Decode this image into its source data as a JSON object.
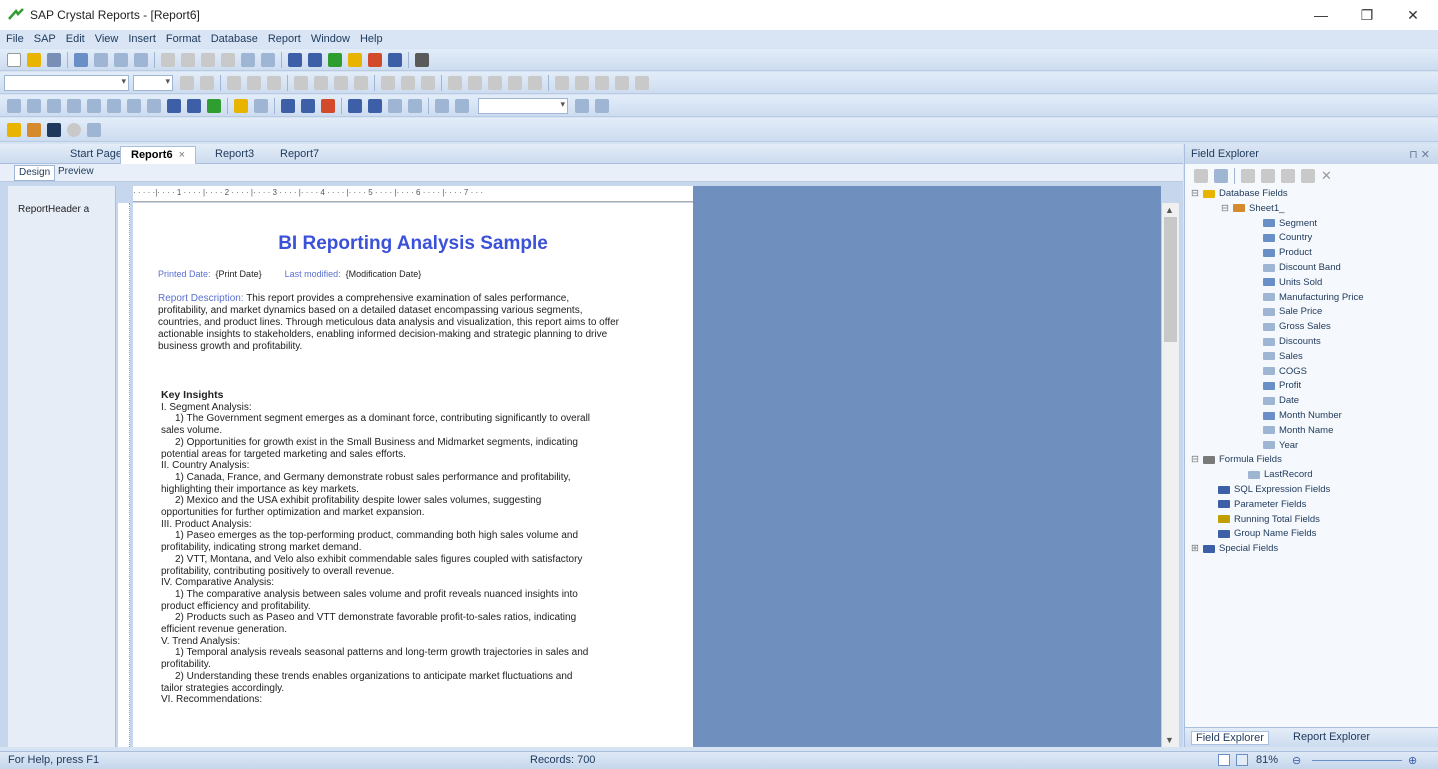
{
  "window": {
    "title": "SAP Crystal Reports - [Report6]",
    "minimize": "—",
    "restore": "❐",
    "close": "✕"
  },
  "menu": [
    "File",
    "SAP",
    "Edit",
    "View",
    "Insert",
    "Format",
    "Database",
    "Report",
    "Window",
    "Help"
  ],
  "tabs": {
    "start": "Start Page",
    "report6": "Report6",
    "close_x": "×",
    "report3": "Report3",
    "report7": "Report7"
  },
  "subtabs": {
    "design": "Design",
    "preview": "Preview"
  },
  "sections": {
    "report_header": "ReportHeader a"
  },
  "ruler": "· · · · ·|· · · · 1 · · · · |· · · · 2 · · · · |· · · · 3 · · · · |· · · · 4 · · · · |· · · · 5 · · · · |· · · · 6 · · · · |· · · · 7 · · ·",
  "report": {
    "title": "BI Reporting Analysis Sample",
    "printed_date_label": "Printed Date:",
    "printed_date_value": "{Print Date}",
    "last_modified_label": "Last modified:",
    "last_modified_value": "{Modification Date}",
    "desc_label": "Report Description:",
    "desc_lines": [
      " This report provides a comprehensive examination of sales performance,",
      "profitability, and market dynamics based on a detailed dataset encompassing various segments,",
      "countries, and product lines. Through meticulous data analysis and visualization, this report aims to offer",
      "actionable insights to stakeholders, enabling informed decision-making and strategic planning to drive",
      "business growth and profitability."
    ],
    "insights_title": "Key Insights",
    "insights": [
      {
        "t": "I. Segment Analysis:",
        "ind": false
      },
      {
        "t": "1) The Government segment emerges as a dominant force, contributing significantly to overall",
        "ind": true
      },
      {
        "t": "sales volume.",
        "ind": false
      },
      {
        "t": "2) Opportunities for growth exist in the Small Business and Midmarket segments, indicating",
        "ind": true
      },
      {
        "t": "potential areas for targeted marketing and sales efforts.",
        "ind": false
      },
      {
        "t": "II. Country Analysis:",
        "ind": false
      },
      {
        "t": "1) Canada, France, and Germany demonstrate robust sales performance and profitability,",
        "ind": true
      },
      {
        "t": "highlighting their importance as key markets.",
        "ind": false
      },
      {
        "t": "2) Mexico and the USA exhibit profitability despite lower sales volumes, suggesting",
        "ind": true
      },
      {
        "t": "opportunities for further optimization and market expansion.",
        "ind": false
      },
      {
        "t": "III. Product Analysis:",
        "ind": false
      },
      {
        "t": "1) Paseo emerges as the top-performing product, commanding both high sales volume and",
        "ind": true
      },
      {
        "t": "profitability, indicating strong market demand.",
        "ind": false
      },
      {
        "t": "2) VTT, Montana, and Velo also exhibit commendable sales figures coupled with satisfactory",
        "ind": true
      },
      {
        "t": "profitability, contributing positively to overall revenue.",
        "ind": false
      },
      {
        "t": "IV. Comparative Analysis:",
        "ind": false
      },
      {
        "t": "1) The comparative analysis between sales volume and profit reveals nuanced insights into",
        "ind": true
      },
      {
        "t": "product efficiency and profitability.",
        "ind": false
      },
      {
        "t": "2) Products such as Paseo and VTT demonstrate favorable profit-to-sales ratios, indicating",
        "ind": true
      },
      {
        "t": "efficient revenue generation.",
        "ind": false
      },
      {
        "t": "V. Trend Analysis:",
        "ind": false
      },
      {
        "t": "1) Temporal analysis reveals seasonal patterns and long-term growth trajectories in sales and",
        "ind": true
      },
      {
        "t": "profitability.",
        "ind": false
      },
      {
        "t": "2) Understanding these trends enables organizations to anticipate market fluctuations and",
        "ind": true
      },
      {
        "t": "tailor strategies accordingly.",
        "ind": false
      },
      {
        "t": "VI. Recommendations:",
        "ind": false
      }
    ]
  },
  "field_explorer": {
    "title": "Field Explorer",
    "pin": "⊓ ✕",
    "nodes": [
      {
        "label": "Database Fields",
        "level": 0,
        "exp": "⊟",
        "icon": "#e8b400"
      },
      {
        "label": "Sheet1_",
        "level": 1,
        "exp": "⊟",
        "icon": "#d58a2b"
      },
      {
        "label": "Segment",
        "level": 2,
        "exp": "",
        "icon": "#6a8fc7"
      },
      {
        "label": "Country",
        "level": 2,
        "exp": "",
        "icon": "#6a8fc7"
      },
      {
        "label": "Product",
        "level": 2,
        "exp": "",
        "icon": "#6a8fc7"
      },
      {
        "label": "Discount Band",
        "level": 2,
        "exp": "",
        "icon": "#9fb5d4"
      },
      {
        "label": "Units Sold",
        "level": 2,
        "exp": "",
        "icon": "#6a8fc7"
      },
      {
        "label": "Manufacturing Price",
        "level": 2,
        "exp": "",
        "icon": "#9fb5d4"
      },
      {
        "label": "Sale Price",
        "level": 2,
        "exp": "",
        "icon": "#9fb5d4"
      },
      {
        "label": "Gross Sales",
        "level": 2,
        "exp": "",
        "icon": "#9fb5d4"
      },
      {
        "label": "Discounts",
        "level": 2,
        "exp": "",
        "icon": "#9fb5d4"
      },
      {
        "label": " Sales",
        "level": 2,
        "exp": "",
        "icon": "#9fb5d4"
      },
      {
        "label": "COGS",
        "level": 2,
        "exp": "",
        "icon": "#9fb5d4"
      },
      {
        "label": "Profit",
        "level": 2,
        "exp": "",
        "icon": "#6a8fc7"
      },
      {
        "label": "Date",
        "level": 2,
        "exp": "",
        "icon": "#9fb5d4"
      },
      {
        "label": "Month Number",
        "level": 2,
        "exp": "",
        "icon": "#6a8fc7"
      },
      {
        "label": "Month Name",
        "level": 2,
        "exp": "",
        "icon": "#9fb5d4"
      },
      {
        "label": "Year",
        "level": 2,
        "exp": "",
        "icon": "#9fb5d4"
      },
      {
        "label": "Formula Fields",
        "level": 0,
        "exp": "⊟",
        "icon": "#7a7a7a"
      },
      {
        "label": "LastRecord",
        "level": 1.5,
        "exp": "",
        "icon": "#9fb5d4"
      },
      {
        "label": "SQL Expression Fields",
        "level": 0.5,
        "exp": "",
        "icon": "#3d5fa8"
      },
      {
        "label": "Parameter Fields",
        "level": 0.5,
        "exp": "",
        "icon": "#3d5fa8"
      },
      {
        "label": "Running Total Fields",
        "level": 0.5,
        "exp": "",
        "icon": "#c0a000"
      },
      {
        "label": "Group Name Fields",
        "level": 0.5,
        "exp": "",
        "icon": "#3d5fa8"
      },
      {
        "label": "Special Fields",
        "level": 0,
        "exp": "⊞",
        "icon": "#3d5fa8"
      }
    ],
    "bottom_tab1": "Field Explorer",
    "bottom_tab2": "Report Explorer"
  },
  "status": {
    "help": "For Help, press F1",
    "records": "Records: 700",
    "zoom": "81%"
  }
}
